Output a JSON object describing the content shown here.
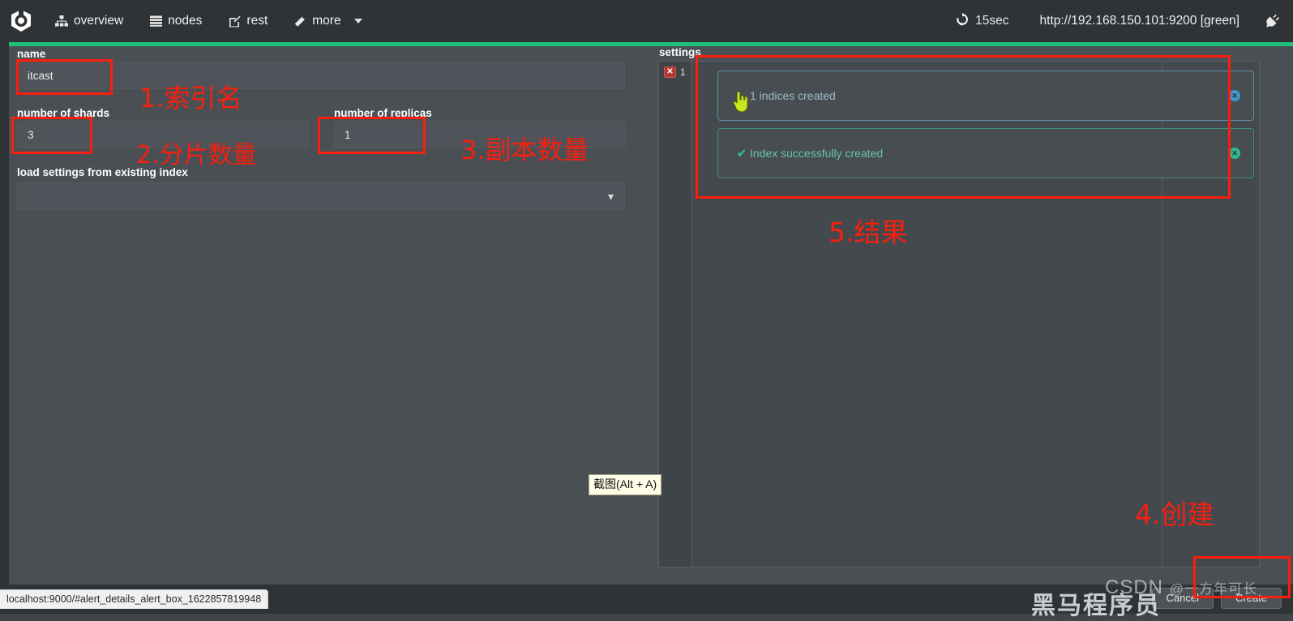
{
  "navbar": {
    "logo_name": "elasticsearch-head-logo",
    "items": [
      {
        "label": "overview",
        "icon": "sitemap-icon"
      },
      {
        "label": "nodes",
        "icon": "server-list-icon"
      },
      {
        "label": "rest",
        "icon": "edit-square-icon"
      },
      {
        "label": "more",
        "icon": "magic-wand-icon",
        "has_caret": true
      }
    ],
    "refresh": {
      "icon": "refresh-icon",
      "label": "15sec"
    },
    "cluster_url": "http://192.168.150.101:9200 [green]",
    "connect_icon": "plug-icon"
  },
  "form": {
    "name_label": "name",
    "name_value": "itcast",
    "shards_label": "number of shards",
    "shards_value": "3",
    "replicas_label": "number of replicas",
    "replicas_value": "1",
    "load_settings_label": "load settings from existing index",
    "load_settings_value": "",
    "load_settings_placeholder": "",
    "chevron_icon": "chevron-down-icon"
  },
  "settings": {
    "title": "settings",
    "error_badge": {
      "icon": "x-icon",
      "count": "1"
    },
    "alerts": [
      {
        "type": "info",
        "icon": "info-icon",
        "glyph": "i",
        "message": "1 indices created",
        "close_icon": "close-circle-icon"
      },
      {
        "type": "success",
        "icon": "check-icon",
        "glyph": "✔",
        "message": "Index successfully created",
        "close_icon": "close-circle-icon"
      }
    ]
  },
  "footer": {
    "buttons": [
      {
        "label": "Cancel",
        "name": "cancel-button"
      },
      {
        "label": "Create",
        "name": "create-button"
      }
    ]
  },
  "status_bar": {
    "link": "localhost:9000/#alert_details_alert_box_1622857819948"
  },
  "tooltip": {
    "text": "截图(Alt + A)"
  },
  "annotations": [
    {
      "id": "1",
      "text": "1.索引名"
    },
    {
      "id": "2",
      "text": "2.分片数量"
    },
    {
      "id": "3",
      "text": "3.副本数量"
    },
    {
      "id": "4",
      "text": "4.创建"
    },
    {
      "id": "5",
      "text": "5.结果"
    }
  ],
  "watermark": {
    "csdn": "CSDN",
    "handle": "@一方年可长",
    "brand": "黑马程序员"
  },
  "colors": {
    "accent_green": "#22c07a",
    "navbar_bg": "#2f3336",
    "panel_bg": "#494f53",
    "annotation_red": "#fa1e0e",
    "info_blue": "#56a8d4",
    "success_green": "#2fb98d"
  }
}
